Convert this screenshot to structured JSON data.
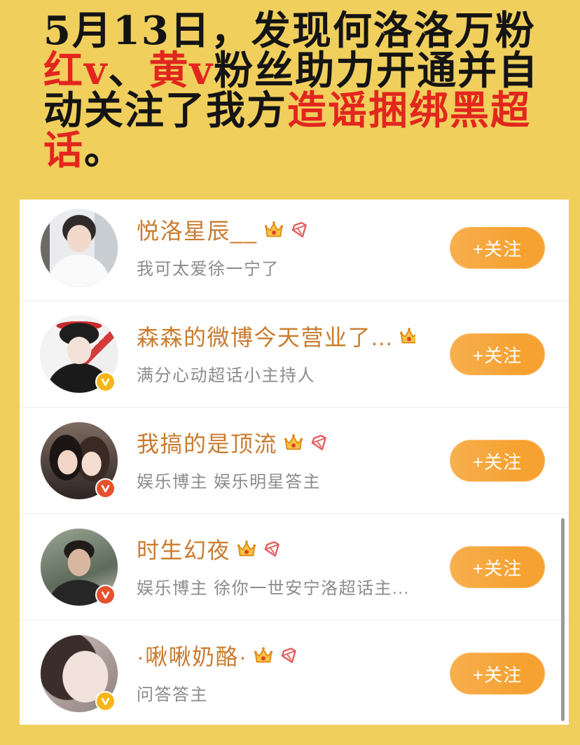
{
  "colors": {
    "page_background": "#f0cf5d",
    "card_background": "#ffffff",
    "headline_text": "#141414",
    "headline_emphasis": "#e2261e",
    "username": "#c97b2e",
    "description": "#8b8b8b",
    "follow_button": "#f6a232",
    "follow_button_text": "#ffffff"
  },
  "headline": {
    "lines": [
      [
        "5月13日，发现何洛洛万粉"
      ],
      [
        "红v",
        "、",
        "黄v",
        "粉丝助力开通并自"
      ],
      [
        "动关注了我方",
        "造谣捆绑黑超"
      ],
      [
        "话",
        "。"
      ]
    ]
  },
  "follow_button_label": "+关注",
  "users": [
    {
      "name": "悦洛星辰__",
      "description": "我可太爱徐一宁了",
      "icons": [
        "crown-icon",
        "diamond-icon"
      ],
      "verified_badge": null
    },
    {
      "name": "森森的微博今天营业了...",
      "description": "满分心动超话小主持人",
      "icons": [
        "crown-icon"
      ],
      "verified_badge": {
        "icon": "verified-v-icon",
        "color": "#f6b619"
      }
    },
    {
      "name": "我搞的是顶流",
      "description": "娱乐博主 娱乐明星答主",
      "icons": [
        "crown-icon",
        "diamond-icon"
      ],
      "verified_badge": {
        "icon": "verified-v-icon",
        "color": "#e5512e"
      }
    },
    {
      "name": "时生幻夜",
      "description": "娱乐博主 徐你一世安宁洛超话主...",
      "icons": [
        "crown-icon",
        "diamond-icon"
      ],
      "verified_badge": {
        "icon": "verified-v-icon",
        "color": "#e5512e"
      }
    },
    {
      "name": "·啾啾奶酪·",
      "description": "问答答主",
      "icons": [
        "crown-icon",
        "diamond-icon"
      ],
      "verified_badge": {
        "icon": "verified-v-icon",
        "color": "#f6b619"
      }
    }
  ]
}
